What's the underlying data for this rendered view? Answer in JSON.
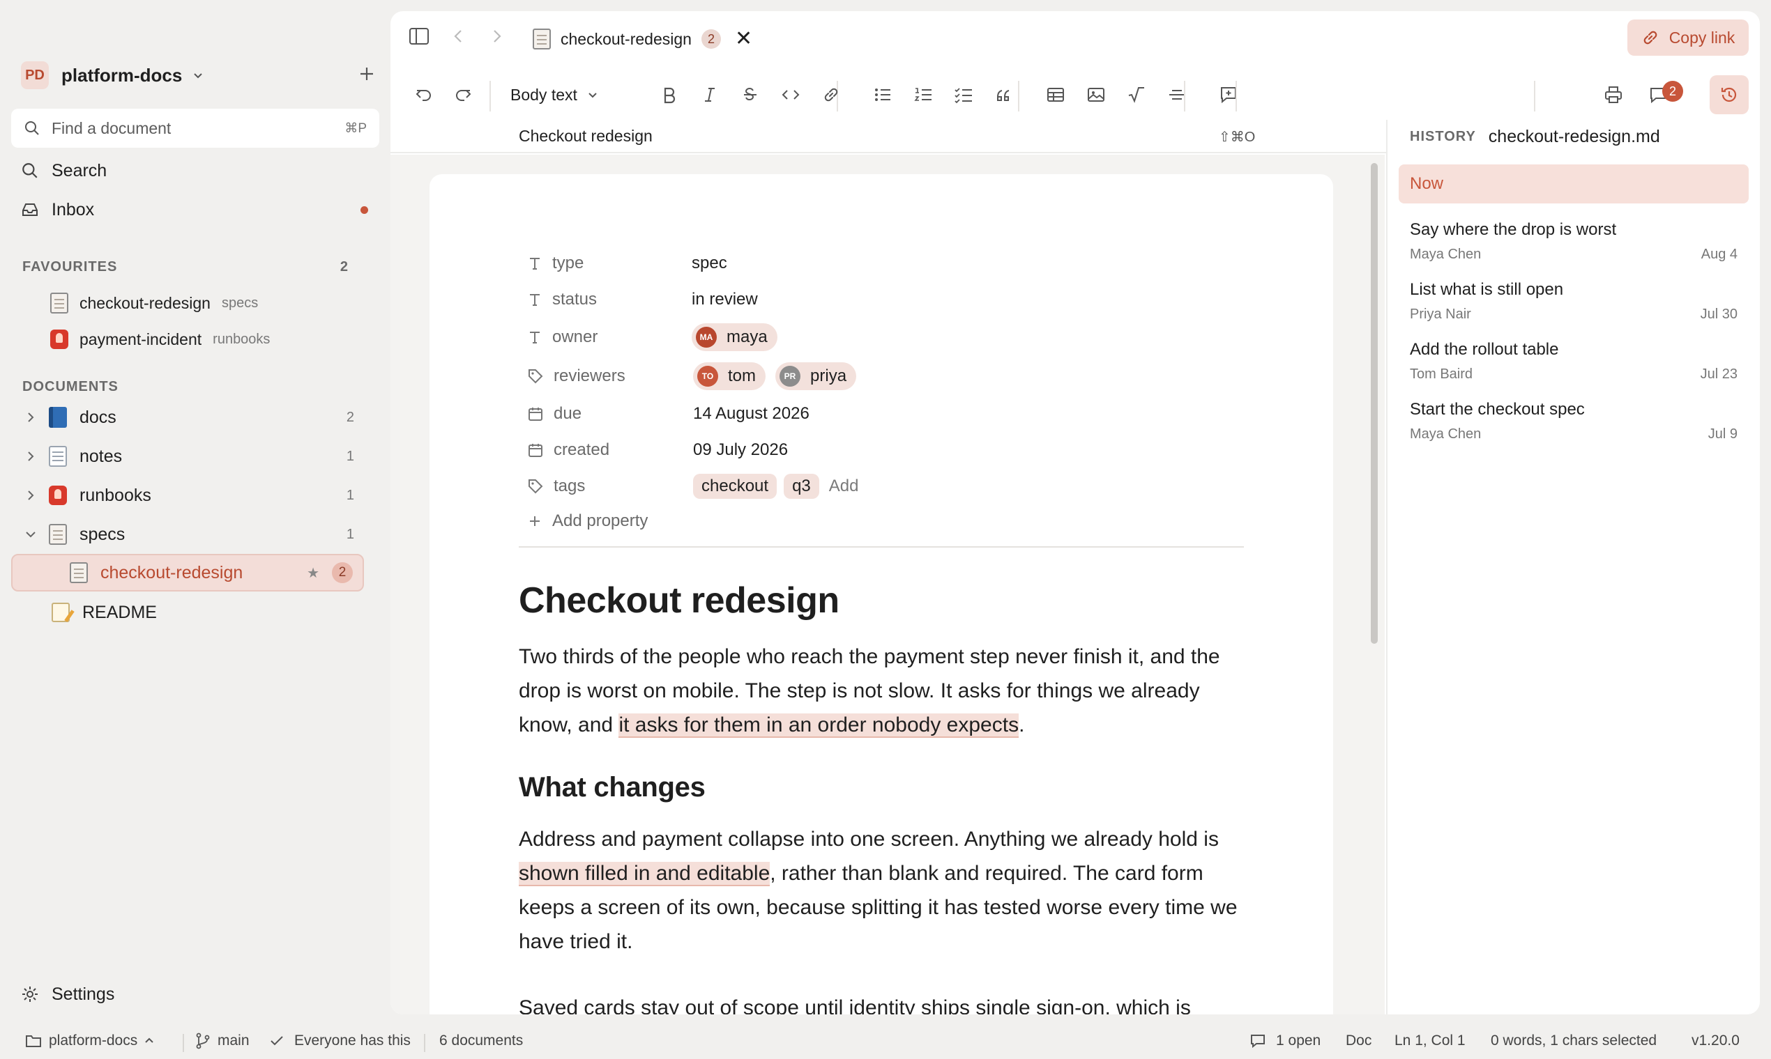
{
  "workspace": {
    "initials": "PD",
    "name": "platform-docs"
  },
  "sidebar": {
    "find_placeholder": "Find a document",
    "find_shortcut": "⌘P",
    "search_label": "Search",
    "inbox_label": "Inbox",
    "favourites": {
      "title": "FAVOURITES",
      "count": "2",
      "items": [
        {
          "name": "checkout-redesign",
          "folder": "specs"
        },
        {
          "name": "payment-incident",
          "folder": "runbooks"
        }
      ]
    },
    "documents": {
      "title": "DOCUMENTS",
      "items": [
        {
          "name": "docs",
          "count": "2"
        },
        {
          "name": "notes",
          "count": "1"
        },
        {
          "name": "runbooks",
          "count": "1"
        },
        {
          "name": "specs",
          "count": "1"
        },
        {
          "name": "checkout-redesign",
          "star": "★",
          "badge": "2"
        },
        {
          "name": "README"
        }
      ]
    },
    "settings_label": "Settings"
  },
  "tabbar": {
    "tab_label": "checkout-redesign",
    "tab_badge": "2",
    "close_glyph": "✕",
    "copy_link_label": "Copy link"
  },
  "toolbar": {
    "style_label": "Body text",
    "comments_badge": "2"
  },
  "crumb": {
    "title": "Checkout redesign",
    "shortcut": "⇧⌘O"
  },
  "properties": [
    {
      "key": "type",
      "value": "spec"
    },
    {
      "key": "status",
      "value": "in review"
    },
    {
      "key": "owner",
      "people": [
        {
          "initials": "MA",
          "name": "maya",
          "color": "#b8472e"
        }
      ]
    },
    {
      "key": "reviewers",
      "people": [
        {
          "initials": "TO",
          "name": "tom",
          "color": "#c8563b"
        },
        {
          "initials": "PR",
          "name": "priya",
          "color": "#8c8c8c"
        }
      ]
    },
    {
      "key": "due",
      "value": "14 August 2026"
    },
    {
      "key": "created",
      "value": "09 July 2026"
    },
    {
      "key": "tags",
      "tags": [
        "checkout",
        "q3"
      ],
      "add_label": "Add"
    }
  ],
  "add_property_label": "Add property",
  "document": {
    "title": "Checkout redesign",
    "p1_a": "Two thirds of the people who reach the payment step never finish it, and the drop is worst on mobile. The step is not slow. It asks for things we already know, and ",
    "p1_hl": "it asks for them in an order nobody expects",
    "p1_b": ".",
    "h2": "What changes",
    "p2_a": "Address and payment collapse into one screen. Anything we already hold is ",
    "p2_hl": "shown filled in and editable",
    "p2_b": ", rather than blank and required. The card form keeps a screen of its own, because splitting it has tested worse every time we have tried it.",
    "p3": "Saved cards stay out of scope until identity ships single sign-on, which is"
  },
  "history": {
    "label": "HISTORY",
    "file": "checkout-redesign.md",
    "now_label": "Now",
    "items": [
      {
        "title": "Say where the drop is worst",
        "author": "Maya Chen",
        "date": "Aug 4"
      },
      {
        "title": "List what is still open",
        "author": "Priya Nair",
        "date": "Jul 30"
      },
      {
        "title": "Add the rollout table",
        "author": "Tom Baird",
        "date": "Jul 23"
      },
      {
        "title": "Start the checkout spec",
        "author": "Maya Chen",
        "date": "Jul 9"
      }
    ]
  },
  "statusbar": {
    "workspace": "platform-docs",
    "branch": "main",
    "sharing": "Everyone has this",
    "doc_count": "6 documents",
    "comments": "1 open",
    "mode": "Doc",
    "cursor": "Ln 1, Col 1",
    "selection": "0 words, 1 chars selected",
    "version": "v1.20.0"
  },
  "colors": {
    "accent": "#c8563b",
    "highlight": "#f5dfd9",
    "chip": "#f3e1dc",
    "background": "#f1f0ee"
  }
}
